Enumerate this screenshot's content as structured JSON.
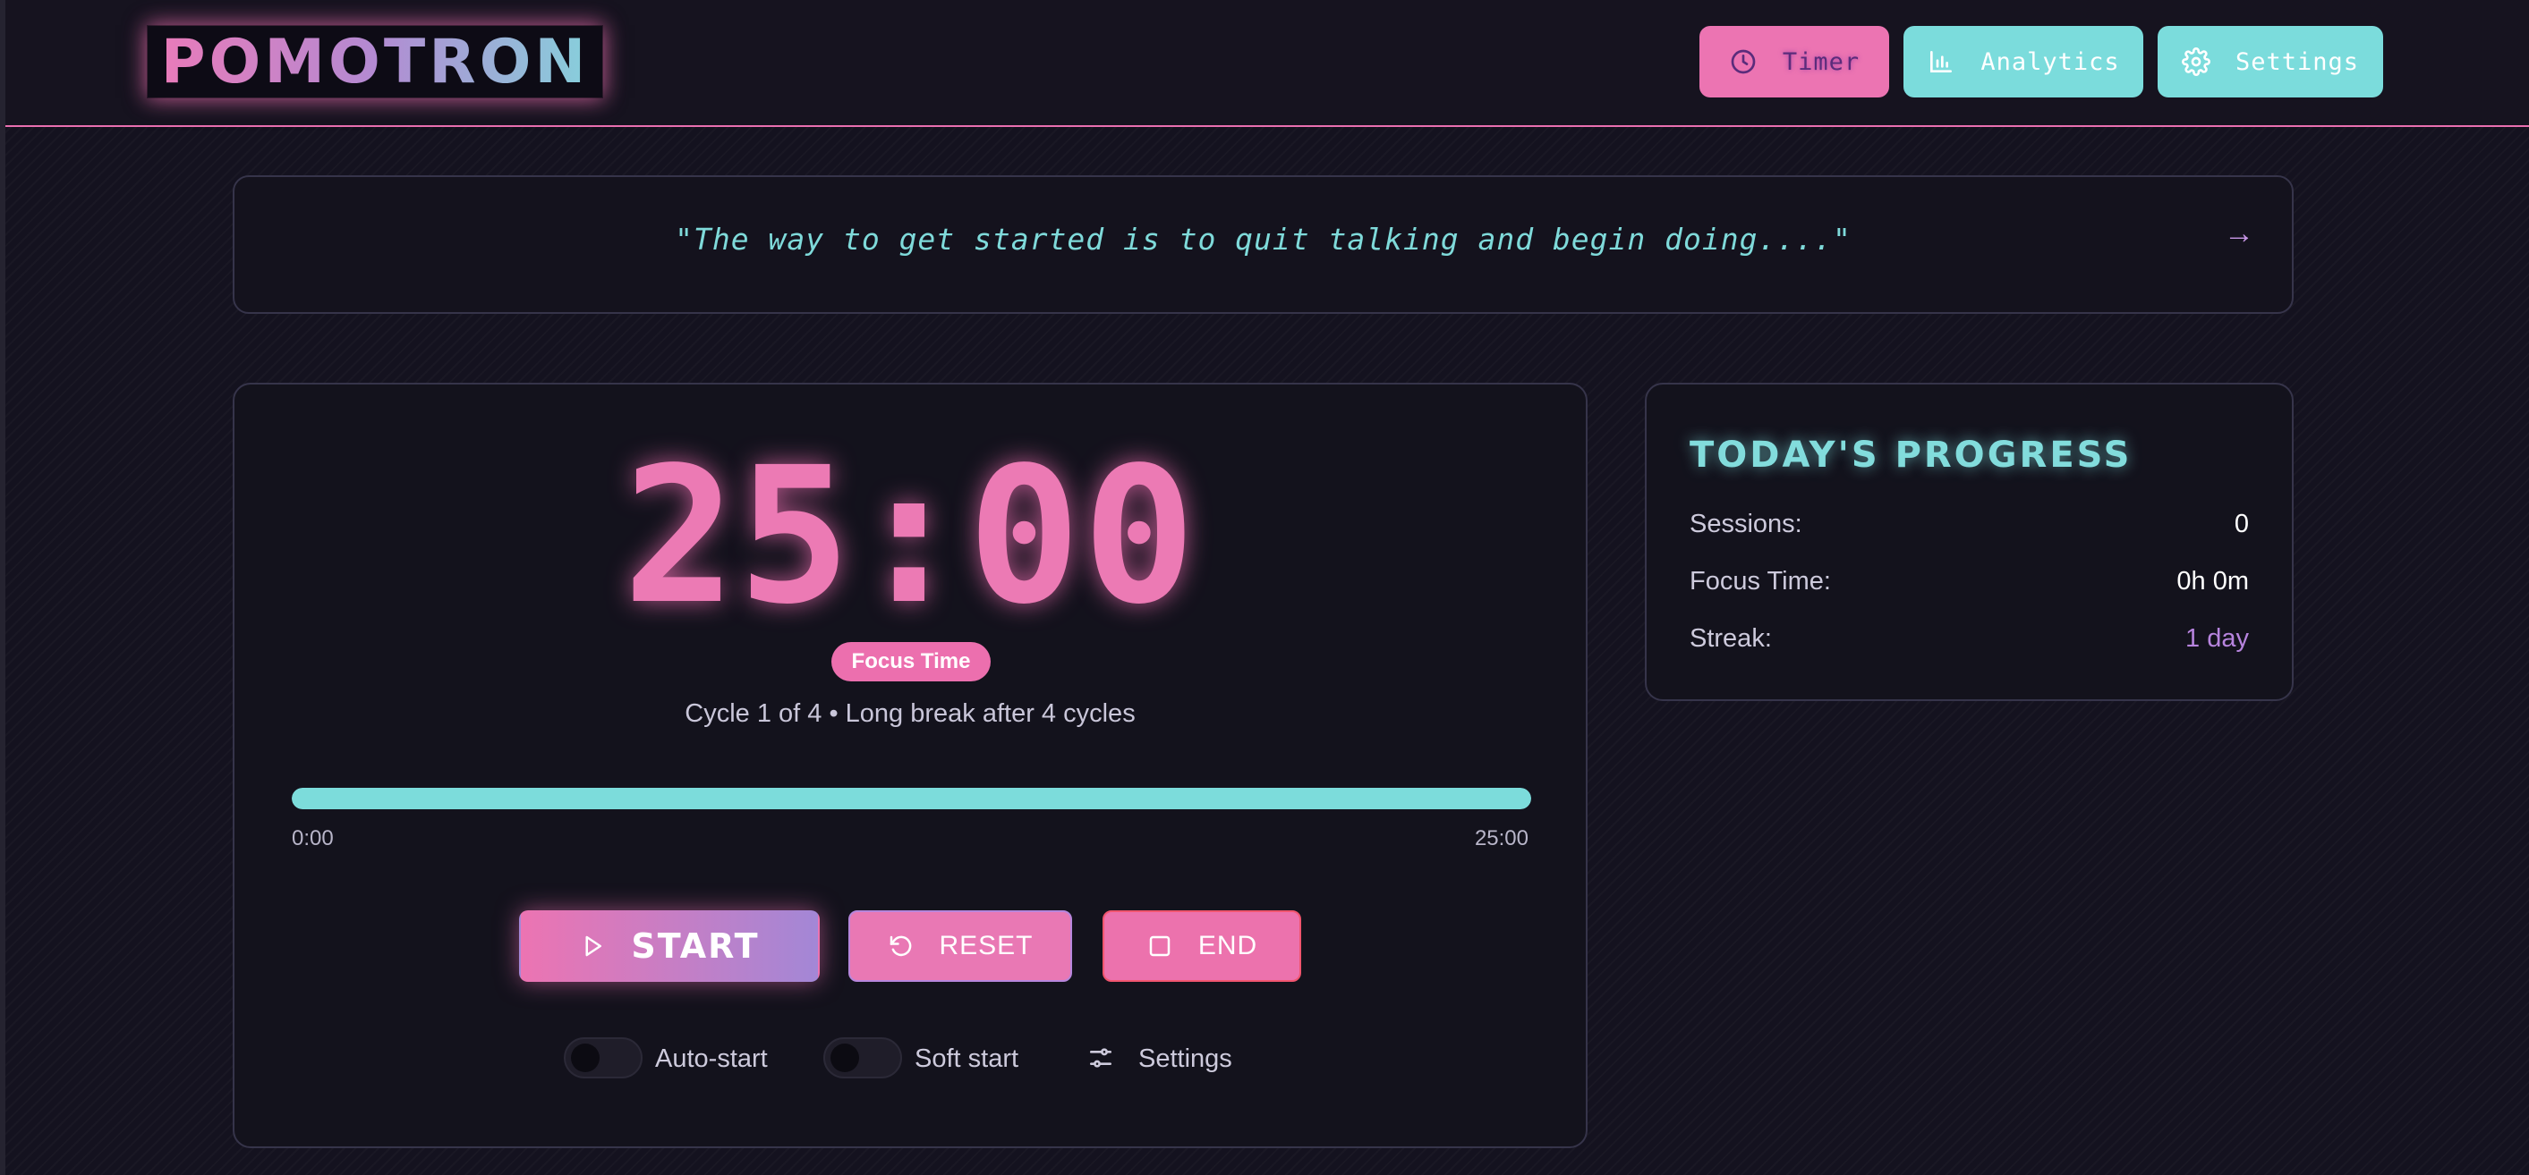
{
  "app": {
    "logo": "POMOTRON"
  },
  "nav": {
    "timer_label": "Timer",
    "analytics_label": "Analytics",
    "settings_label": "Settings"
  },
  "quote": {
    "text": "\"The way to get started is to quit talking and begin doing....\"",
    "next_arrow": "→"
  },
  "timer": {
    "display": "25:00",
    "mode_badge": "Focus Time",
    "cycle_text": "Cycle 1 of 4 • Long break after 4 cycles",
    "progress_fraction": 1.0,
    "elapsed_label": "0:00",
    "total_label": "25:00",
    "start_label": "START",
    "reset_label": "RESET",
    "end_label": "END",
    "auto_start_label": "Auto-start",
    "auto_start_on": false,
    "soft_start_label": "Soft start",
    "soft_start_on": false,
    "settings_label": "Settings"
  },
  "progress": {
    "title": "TODAY'S PROGRESS",
    "sessions_label": "Sessions:",
    "sessions_value": "0",
    "focus_time_label": "Focus Time:",
    "focus_time_value": "0h 0m",
    "streak_label": "Streak:",
    "streak_value": "1 day"
  },
  "colors": {
    "pink": "#ec74b2",
    "cyan": "#7bdcdc",
    "purple": "#b784de",
    "background": "#14121f"
  },
  "icons": {
    "timer": "clock-icon",
    "analytics": "bar-chart-icon",
    "settings": "gear-icon",
    "start": "play-icon",
    "reset": "rotate-ccw-icon",
    "end": "stop-square-icon",
    "timer_settings": "sliders-icon"
  }
}
